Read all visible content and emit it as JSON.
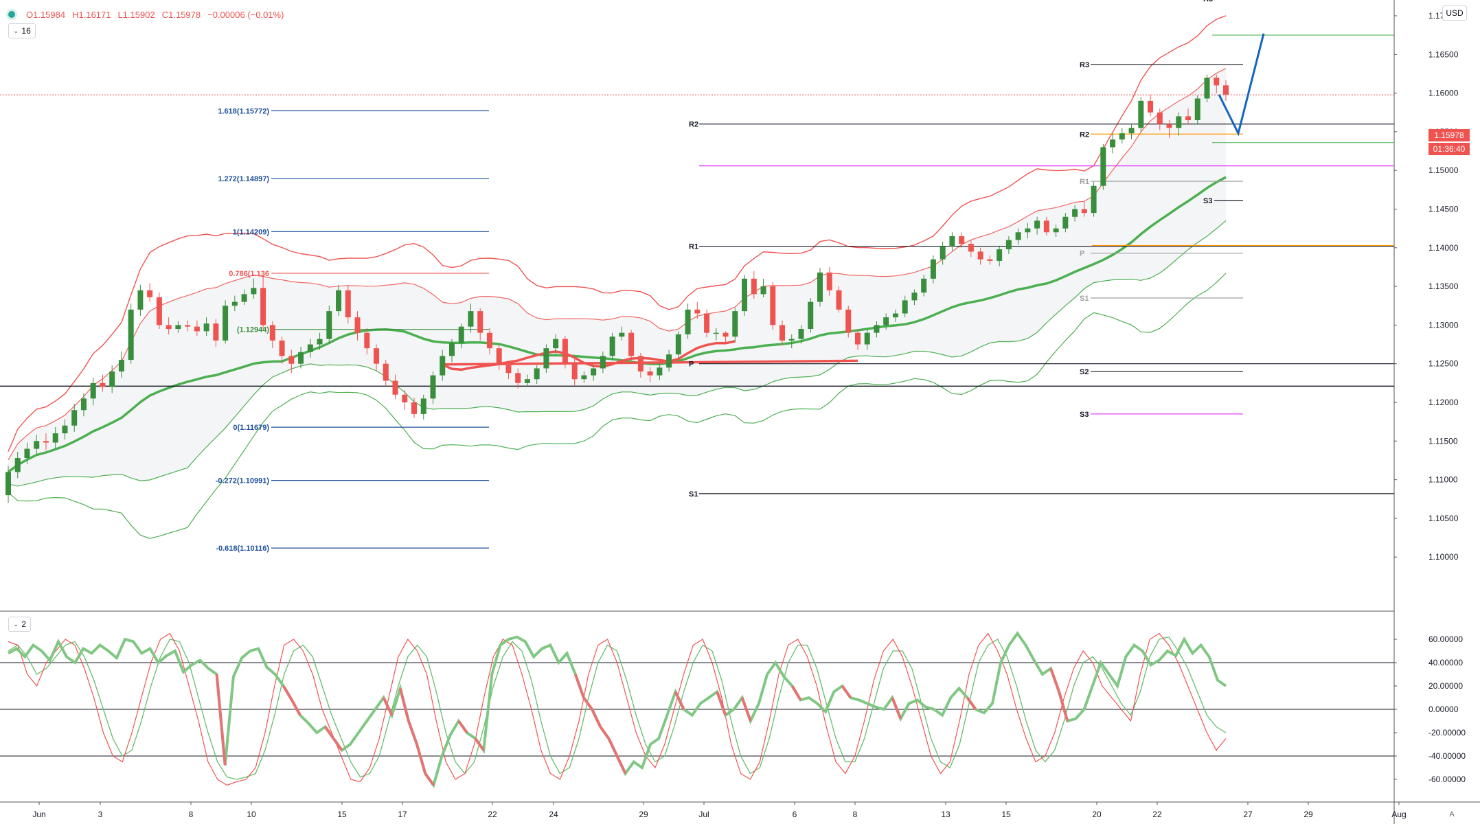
{
  "header": {
    "open": "O1.15984",
    "high": "H1.16171",
    "low": "L1.15902",
    "close": "C1.15978",
    "change": "−0.00006 (−0.01%)",
    "main_indicator_count": "16",
    "osc_indicator_count": "2"
  },
  "currency_label": "USD",
  "last_price": "1.15978",
  "countdown": "01:36:40",
  "auto_label": "A",
  "colors": {
    "bull": "#388e3c",
    "bear": "#ef5350",
    "band_red": "#ef5350",
    "band_green": "#4caf50",
    "fib": "#1e4f9c",
    "pivot": "#131722",
    "magenta": "#e040fb",
    "orange": "#ff9800",
    "projection": "#1565c0",
    "price_tag": "#ef5350"
  },
  "chart_data": [
    {
      "type": "candlestick",
      "title": "",
      "date_labels": [
        "Jun",
        "3",
        "8",
        "10",
        "15",
        "17",
        "22",
        "24",
        "29",
        "Jul",
        "6",
        "8",
        "13",
        "15",
        "20",
        "22",
        "27",
        "29",
        "Aug"
      ],
      "y_ticks": [
        "1.17000",
        "1.16500",
        "1.16000",
        "1.15500",
        "1.15000",
        "1.14500",
        "1.14000",
        "1.13500",
        "1.13000",
        "1.12500",
        "1.12000",
        "1.11500",
        "1.11000",
        "1.10500",
        "1.10000"
      ],
      "ylim": [
        1.0975,
        1.1745
      ],
      "candles": {
        "open": [
          1.108,
          1.111,
          1.1128,
          1.114,
          1.115,
          1.1148,
          1.116,
          1.117,
          1.119,
          1.1205,
          1.1225,
          1.122,
          1.124,
          1.1255,
          1.132,
          1.1345,
          1.1336,
          1.13,
          1.1295,
          1.13,
          1.1298,
          1.1292,
          1.1302,
          1.128,
          1.1325,
          1.133,
          1.134,
          1.1348,
          1.13,
          1.128,
          1.126,
          1.125,
          1.1265,
          1.1275,
          1.1282,
          1.1318,
          1.1345,
          1.131,
          1.129,
          1.127,
          1.125,
          1.1228,
          1.121,
          1.12,
          1.1185,
          1.1205,
          1.1235,
          1.126,
          1.1277,
          1.1298,
          1.1318,
          1.129,
          1.127,
          1.1248,
          1.1238,
          1.1225,
          1.123,
          1.1244,
          1.127,
          1.1282,
          1.125,
          1.123,
          1.1235,
          1.1244,
          1.126,
          1.1285,
          1.129,
          1.126,
          1.124,
          1.1235,
          1.1245,
          1.1262,
          1.1288,
          1.132,
          1.1315,
          1.129,
          1.129,
          1.1285,
          1.1318,
          1.136,
          1.134,
          1.135,
          1.13,
          1.128,
          1.1282,
          1.1295,
          1.133,
          1.1368,
          1.1345,
          1.132,
          1.129,
          1.1275,
          1.129,
          1.13,
          1.131,
          1.1315,
          1.1332,
          1.1342,
          1.136,
          1.1385,
          1.1402,
          1.1415,
          1.1405,
          1.1395,
          1.1385,
          1.1383,
          1.1398,
          1.141,
          1.142,
          1.1425,
          1.1435,
          1.142,
          1.1425,
          1.144,
          1.145,
          1.1445,
          1.148,
          1.153,
          1.154,
          1.1548,
          1.1555,
          1.159,
          1.1575,
          1.156,
          1.1555,
          1.157,
          1.1565,
          1.1593,
          1.162,
          1.161
        ],
        "high": [
          1.1118,
          1.1136,
          1.1148,
          1.1158,
          1.116,
          1.1168,
          1.1178,
          1.1198,
          1.1212,
          1.1232,
          1.1236,
          1.1248,
          1.1266,
          1.1328,
          1.1352,
          1.1354,
          1.1342,
          1.131,
          1.1305,
          1.1306,
          1.1306,
          1.131,
          1.1308,
          1.1332,
          1.1338,
          1.1346,
          1.136,
          1.1365,
          1.1305,
          1.1285,
          1.1268,
          1.1272,
          1.1282,
          1.129,
          1.1325,
          1.1352,
          1.1352,
          1.1318,
          1.1296,
          1.1275,
          1.1255,
          1.1236,
          1.1216,
          1.1206,
          1.121,
          1.124,
          1.1268,
          1.1282,
          1.1302,
          1.1328,
          1.1322,
          1.1296,
          1.1275,
          1.1252,
          1.1244,
          1.1236,
          1.1248,
          1.1275,
          1.1288,
          1.1286,
          1.1256,
          1.124,
          1.1248,
          1.1266,
          1.129,
          1.1298,
          1.1294,
          1.1264,
          1.1246,
          1.125,
          1.1268,
          1.1292,
          1.1328,
          1.133,
          1.132,
          1.1296,
          1.1292,
          1.1322,
          1.1365,
          1.137,
          1.136,
          1.1356,
          1.1306,
          1.1288,
          1.13,
          1.1335,
          1.1374,
          1.1375,
          1.135,
          1.1325,
          1.1295,
          1.1295,
          1.1305,
          1.1315,
          1.132,
          1.1338,
          1.1346,
          1.1365,
          1.139,
          1.1408,
          1.142,
          1.142,
          1.141,
          1.14,
          1.139,
          1.1402,
          1.1415,
          1.1425,
          1.1432,
          1.144,
          1.144,
          1.143,
          1.1445,
          1.1455,
          1.146,
          1.1485,
          1.1534,
          1.1548,
          1.1555,
          1.156,
          1.1595,
          1.1598,
          1.158,
          1.1565,
          1.1575,
          1.158,
          1.1597,
          1.1624,
          1.1624,
          1.1617
        ],
        "low": [
          1.107,
          1.1102,
          1.112,
          1.1132,
          1.1138,
          1.114,
          1.1152,
          1.1162,
          1.1182,
          1.1196,
          1.1214,
          1.1212,
          1.1232,
          1.125,
          1.1312,
          1.133,
          1.1295,
          1.1288,
          1.129,
          1.1292,
          1.1286,
          1.1286,
          1.1272,
          1.1276,
          1.1318,
          1.1326,
          1.1334,
          1.1295,
          1.127,
          1.125,
          1.1238,
          1.1244,
          1.1258,
          1.1268,
          1.1276,
          1.1312,
          1.1302,
          1.128,
          1.1262,
          1.124,
          1.1222,
          1.1204,
          1.119,
          1.118,
          1.1178,
          1.1198,
          1.1228,
          1.1252,
          1.127,
          1.129,
          1.128,
          1.1262,
          1.1242,
          1.123,
          1.1218,
          1.122,
          1.1224,
          1.1238,
          1.1262,
          1.1244,
          1.1222,
          1.1225,
          1.1228,
          1.1238,
          1.1254,
          1.128,
          1.1254,
          1.1232,
          1.1226,
          1.1229,
          1.124,
          1.1256,
          1.1282,
          1.1308,
          1.1284,
          1.128,
          1.1278,
          1.1278,
          1.1312,
          1.1334,
          1.1336,
          1.1294,
          1.1274,
          1.127,
          1.1276,
          1.129,
          1.1324,
          1.1338,
          1.1316,
          1.1284,
          1.1268,
          1.1268,
          1.1284,
          1.1294,
          1.1304,
          1.131,
          1.1326,
          1.1337,
          1.1354,
          1.1378,
          1.1396,
          1.14,
          1.1388,
          1.1378,
          1.1378,
          1.1376,
          1.1392,
          1.1404,
          1.1412,
          1.1417,
          1.1416,
          1.1414,
          1.142,
          1.1434,
          1.144,
          1.144,
          1.1475,
          1.1522,
          1.1535,
          1.154,
          1.155,
          1.157,
          1.1552,
          1.1542,
          1.1545,
          1.156,
          1.156,
          1.1588,
          1.16,
          1.159
        ],
        "close": [
          1.111,
          1.1128,
          1.114,
          1.115,
          1.1148,
          1.116,
          1.117,
          1.119,
          1.1205,
          1.1225,
          1.122,
          1.124,
          1.1255,
          1.132,
          1.1345,
          1.1336,
          1.13,
          1.1295,
          1.13,
          1.1298,
          1.1292,
          1.1302,
          1.128,
          1.1325,
          1.133,
          1.134,
          1.1348,
          1.13,
          1.128,
          1.126,
          1.125,
          1.1265,
          1.1275,
          1.1282,
          1.1318,
          1.1345,
          1.131,
          1.129,
          1.127,
          1.125,
          1.1228,
          1.121,
          1.12,
          1.1185,
          1.1205,
          1.1235,
          1.126,
          1.1277,
          1.1298,
          1.1318,
          1.129,
          1.127,
          1.1248,
          1.1238,
          1.1225,
          1.123,
          1.1244,
          1.127,
          1.1282,
          1.125,
          1.123,
          1.1235,
          1.1244,
          1.126,
          1.1285,
          1.129,
          1.126,
          1.124,
          1.1235,
          1.1245,
          1.1262,
          1.1288,
          1.132,
          1.1315,
          1.129,
          1.129,
          1.1285,
          1.1318,
          1.136,
          1.134,
          1.135,
          1.13,
          1.128,
          1.1282,
          1.1295,
          1.133,
          1.1368,
          1.1345,
          1.132,
          1.129,
          1.1275,
          1.129,
          1.13,
          1.131,
          1.1315,
          1.1332,
          1.1342,
          1.136,
          1.1385,
          1.1402,
          1.1415,
          1.1405,
          1.1395,
          1.1385,
          1.1383,
          1.1398,
          1.141,
          1.142,
          1.1425,
          1.1435,
          1.142,
          1.1425,
          1.144,
          1.145,
          1.1445,
          1.148,
          1.153,
          1.154,
          1.1548,
          1.1555,
          1.159,
          1.1575,
          1.156,
          1.1555,
          1.157,
          1.1565,
          1.1593,
          1.162,
          1.161,
          1.1598
        ]
      },
      "levels": [
        {
          "label": "1.618(1.15772)",
          "value": 1.15772,
          "kind": "fib"
        },
        {
          "label": "1.272(1.14897)",
          "value": 1.14897,
          "kind": "fib"
        },
        {
          "label": "1(1.14209)",
          "value": 1.14209,
          "kind": "fib"
        },
        {
          "label": "0.786(1.136",
          "value": 1.1367,
          "kind": "fib_red"
        },
        {
          "label": "(1.12944)",
          "value": 1.12944,
          "kind": "fib_green"
        },
        {
          "label": "0(1.11679)",
          "value": 1.11679,
          "kind": "fib"
        },
        {
          "label": "-0.272(1.10991)",
          "value": 1.10991,
          "kind": "fib"
        },
        {
          "label": "-0.618(1.10116)",
          "value": 1.10116,
          "kind": "fib"
        },
        {
          "label": "R3",
          "value": 1.1724,
          "kind": "pivot_long"
        },
        {
          "label": "R2",
          "value": 1.156,
          "kind": "pivot_long"
        },
        {
          "label": "R1",
          "value": 1.1402,
          "kind": "pivot_long"
        },
        {
          "label": "P",
          "value": 1.125,
          "kind": "pivot_long"
        },
        {
          "label": "S1",
          "value": 1.1082,
          "kind": "pivot_long"
        },
        {
          "label": "R3",
          "value": 1.1722,
          "kind": "pivot_short"
        },
        {
          "label": "R3",
          "value": 1.1637,
          "kind": "pivot_short"
        },
        {
          "label": "R2",
          "value": 1.1547,
          "kind": "pivot_short_orange"
        },
        {
          "label": "R1",
          "value": 1.1486,
          "kind": "pivot_short_gray"
        },
        {
          "label": "S3",
          "value": 1.1461,
          "kind": "pivot_short"
        },
        {
          "label": "P",
          "value": 1.1393,
          "kind": "pivot_short_gray"
        },
        {
          "label": "S1",
          "value": 1.1335,
          "kind": "pivot_short_gray"
        },
        {
          "label": "S2",
          "value": 1.124,
          "kind": "pivot_short"
        },
        {
          "label": "S3",
          "value": 1.1185,
          "kind": "pivot_short_magenta"
        }
      ],
      "extra_lines": [
        {
          "value": 1.1506,
          "kind": "magenta"
        },
        {
          "value": 1.1221,
          "kind": "black"
        },
        {
          "value": 1.1675,
          "kind": "green"
        },
        {
          "value": 1.1536,
          "kind": "green"
        },
        {
          "value": 1.1403,
          "kind": "orange"
        },
        {
          "value": 1.15978,
          "kind": "red_dotted"
        }
      ]
    },
    {
      "type": "line",
      "title": "",
      "y_ticks": [
        "60.00000",
        "40.00000",
        "20.00000",
        "0.00000",
        "-20.00000",
        "-40.00000",
        "-60.00000"
      ],
      "ylim": [
        -72,
        72
      ],
      "levels": [
        40,
        0,
        -40
      ],
      "series_main": [
        48,
        52,
        45,
        55,
        50,
        42,
        58,
        45,
        40,
        52,
        48,
        55,
        50,
        44,
        60,
        58,
        48,
        52,
        40,
        46,
        50,
        32,
        38,
        42,
        35,
        30,
        -48,
        28,
        44,
        50,
        52,
        36,
        30,
        20,
        8,
        -5,
        -12,
        -20,
        -15,
        -25,
        -35,
        -30,
        -20,
        -10,
        0,
        10,
        -5,
        18,
        -10,
        -30,
        -55,
        -65,
        -40,
        -22,
        -10,
        -20,
        -25,
        -35,
        30,
        55,
        60,
        62,
        58,
        45,
        52,
        55,
        40,
        48,
        30,
        10,
        0,
        -15,
        -25,
        -40,
        -55,
        -45,
        -50,
        -30,
        -25,
        -5,
        15,
        0,
        -5,
        5,
        10,
        15,
        -5,
        0,
        10,
        -10,
        5,
        30,
        40,
        28,
        20,
        8,
        10,
        5,
        -2,
        15,
        20,
        10,
        8,
        5,
        2,
        0,
        10,
        -8,
        5,
        8,
        2,
        0,
        -5,
        10,
        18,
        10,
        0,
        -3,
        5,
        40,
        55,
        65,
        55,
        42,
        30,
        35,
        15,
        -10,
        -8,
        0,
        20,
        40,
        30,
        20,
        45,
        55,
        50,
        38,
        42,
        50,
        46,
        60,
        48,
        55,
        45,
        25,
        20
      ],
      "series_fast": [
        58,
        55,
        30,
        20,
        40,
        50,
        60,
        55,
        35,
        10,
        -20,
        -40,
        -45,
        -20,
        10,
        40,
        60,
        65,
        50,
        20,
        -10,
        -45,
        -60,
        -65,
        -62,
        -60,
        -50,
        -20,
        20,
        55,
        60,
        50,
        30,
        0,
        -20,
        -40,
        -60,
        -62,
        -50,
        -25,
        10,
        45,
        60,
        50,
        30,
        -10,
        -45,
        -60,
        -55,
        -30,
        10,
        45,
        60,
        55,
        30,
        0,
        -35,
        -55,
        -60,
        -40,
        -10,
        30,
        55,
        60,
        40,
        10,
        -20,
        -40,
        -50,
        -30,
        0,
        30,
        55,
        60,
        40,
        10,
        -30,
        -55,
        -60,
        -45,
        -10,
        30,
        55,
        60,
        45,
        20,
        -15,
        -45,
        -55,
        -40,
        -10,
        25,
        50,
        60,
        45,
        20,
        -10,
        -40,
        -55,
        -45,
        -10,
        30,
        55,
        65,
        50,
        30,
        0,
        -25,
        -45,
        -40,
        -20,
        10,
        35,
        50,
        40,
        20,
        10,
        0,
        -10,
        30,
        60,
        65,
        55,
        40,
        20,
        0,
        -20,
        -35,
        -25
      ],
      "series_slow": [
        50,
        55,
        45,
        30,
        35,
        45,
        55,
        58,
        45,
        25,
        0,
        -25,
        -40,
        -35,
        -10,
        20,
        45,
        60,
        58,
        40,
        10,
        -20,
        -45,
        -58,
        -60,
        -58,
        -55,
        -35,
        -5,
        30,
        50,
        55,
        45,
        20,
        -5,
        -25,
        -45,
        -58,
        -55,
        -40,
        -10,
        20,
        45,
        55,
        45,
        15,
        -20,
        -45,
        -55,
        -45,
        -15,
        20,
        45,
        58,
        50,
        25,
        -10,
        -40,
        -55,
        -50,
        -25,
        10,
        40,
        55,
        50,
        25,
        -5,
        -30,
        -45,
        -40,
        -15,
        15,
        40,
        55,
        50,
        25,
        -10,
        -40,
        -55,
        -50,
        -25,
        10,
        40,
        55,
        55,
        35,
        5,
        -25,
        -45,
        -45,
        -25,
        5,
        35,
        50,
        50,
        35,
        5,
        -25,
        -45,
        -50,
        -30,
        5,
        40,
        55,
        60,
        45,
        20,
        -10,
        -35,
        -45,
        -35,
        -10,
        20,
        40,
        45,
        35,
        20,
        5,
        -5,
        15,
        45,
        60,
        62,
        50,
        35,
        15,
        -5,
        -15,
        -20
      ]
    }
  ]
}
